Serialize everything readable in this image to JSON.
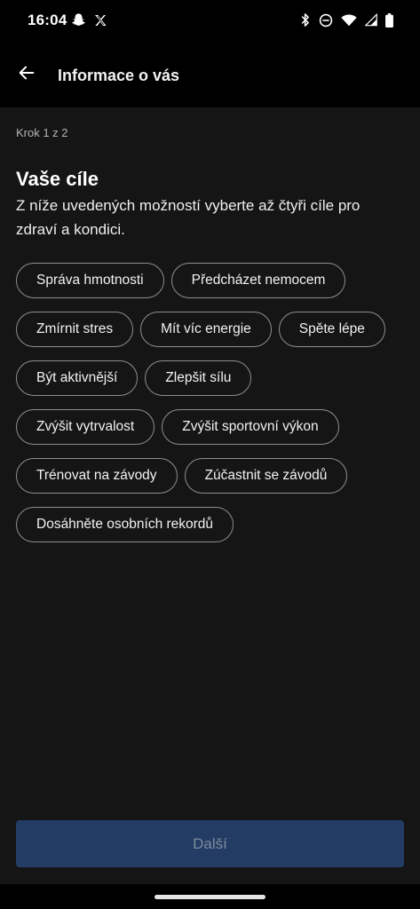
{
  "status_bar": {
    "time": "16:04",
    "left_icons": [
      "snapchat-icon",
      "x-icon"
    ],
    "right_icons": [
      "bluetooth-icon",
      "do-not-disturb-icon",
      "wifi-icon",
      "signal-icon",
      "battery-icon"
    ]
  },
  "app_bar": {
    "title": "Informace o vás"
  },
  "page": {
    "step": "Krok 1 z 2",
    "title": "Vaše cíle",
    "description": "Z níže uvedených možností vyberte až čtyři cíle pro zdraví a kondici."
  },
  "goals": [
    [
      "Správa hmotnosti",
      "Předcházet nemocem"
    ],
    [
      "Zmírnit stres",
      "Mít víc energie",
      "Spěte lépe"
    ],
    [
      "Být aktivnější",
      "Zlepšit sílu"
    ],
    [
      "Zvýšit vytrvalost",
      "Zvýšit sportovní výkon"
    ],
    [
      "Trénovat na závody",
      "Zúčastnit se závodů"
    ],
    [
      "Dosáhněte osobních rekordů"
    ]
  ],
  "actions": {
    "next_label": "Další"
  },
  "colors": {
    "background": "#151515",
    "bar_background": "#000000",
    "chip_border": "#8e8e8e",
    "next_button": "#223c63",
    "next_button_text": "#7f8ba0"
  }
}
